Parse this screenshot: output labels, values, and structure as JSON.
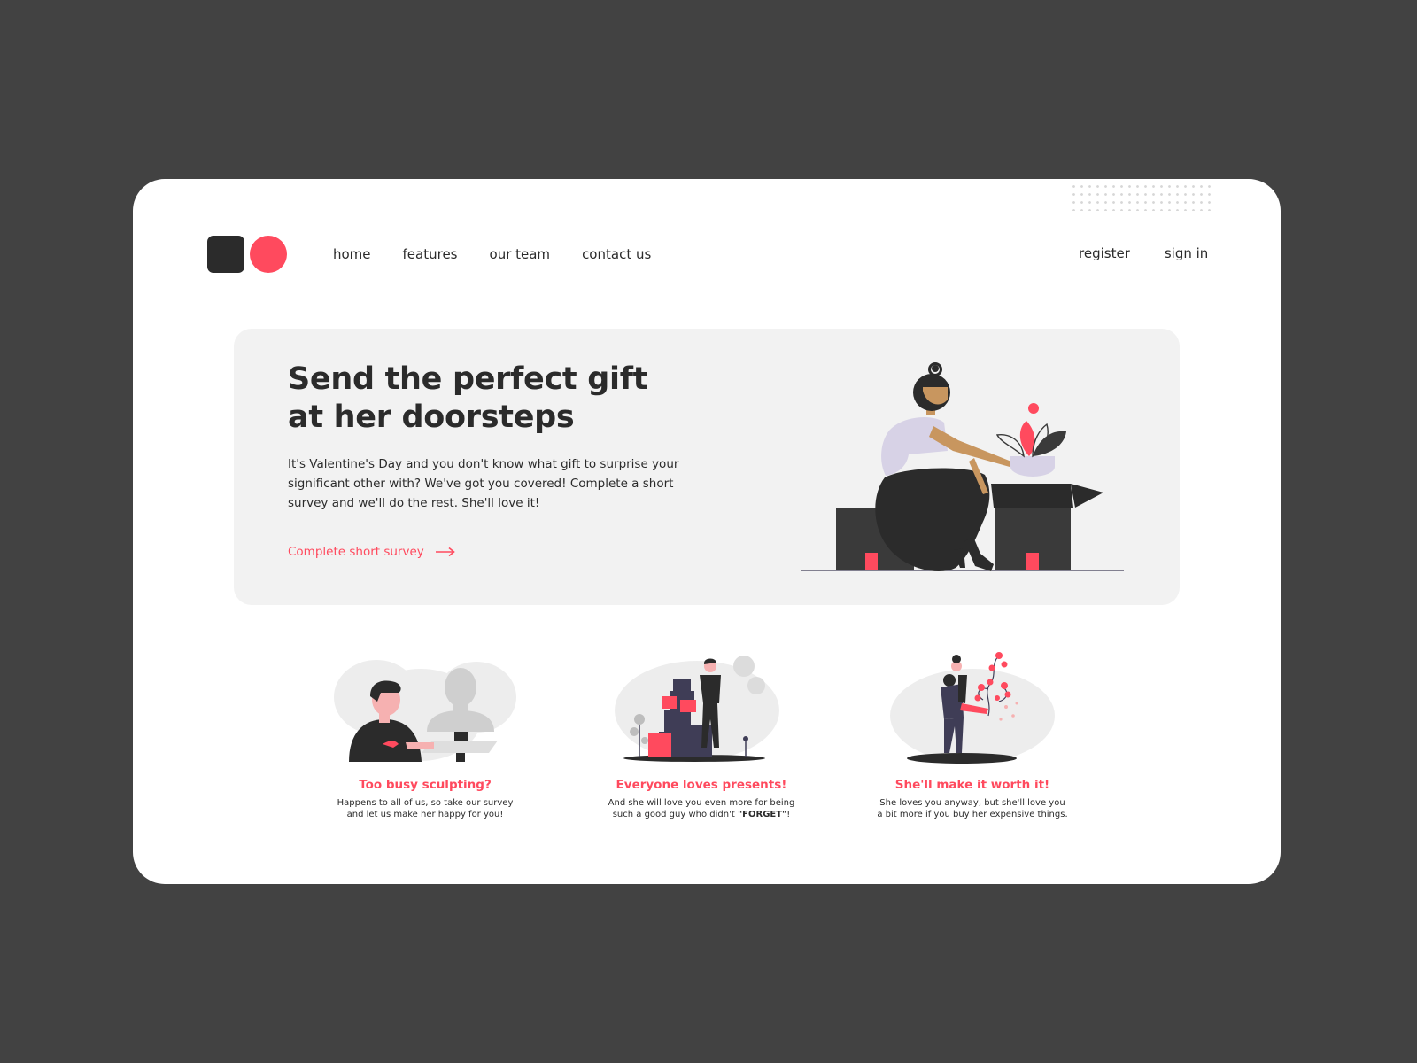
{
  "colors": {
    "background": "#424242",
    "card": "#ffffff",
    "accent": "#ff4a5e",
    "dark": "#2b2b2b",
    "hero_bg": "#f2f2f2"
  },
  "logo": {
    "icons": [
      "square-icon",
      "circle-icon"
    ]
  },
  "nav": {
    "items": [
      "home",
      "features",
      "our team",
      "contact us"
    ]
  },
  "auth": {
    "register": "register",
    "sign_in": "sign in"
  },
  "hero": {
    "title_line1": "Send the perfect gift",
    "title_line2": "at her doorsteps",
    "body": "It's Valentine's Day and you don't know what gift to surprise your significant other with? We've got you covered! Complete a short survey and we'll do the rest. She'll love it!",
    "cta": "Complete short survey",
    "cta_icon": "arrow-right-icon"
  },
  "features": [
    {
      "title": "Too busy sculpting?",
      "line1": "Happens to all of us, so take our survey",
      "line2": "and let us make her happy for you!"
    },
    {
      "title": "Everyone loves presents!",
      "line1": "And she will love you even more for being",
      "line2_pre": "such a good guy who didn't ",
      "line2_bold": "\"FORGET\"",
      "line2_post": "!"
    },
    {
      "title": "She'll make it worth it!",
      "line1": "She loves you anyway, but she'll love you",
      "line2": "a bit more if you buy her expensive things."
    }
  ]
}
